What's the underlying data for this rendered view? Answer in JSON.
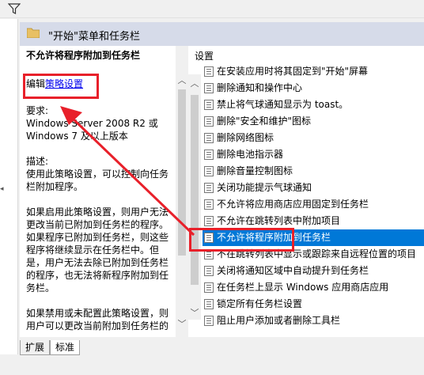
{
  "header": {
    "title": "\"开始\"菜单和任务栏"
  },
  "description": {
    "title": "不允许将程序附加到任务栏",
    "edit_prefix": "编辑",
    "edit_link": "策略设置",
    "req_label": "要求:",
    "req_text": "Windows Server 2008 R2 或 Windows 7 及以上版本",
    "desc_label": "描述:",
    "desc_text": "使用此策略设置，可以控制向任务栏附加程序。",
    "p1": "如果启用此策略设置，则用户无法更改当前已附加到任务栏的程序。如果程序已附加到任务栏，则这些程序将继续显示在任务栏中。但是，用户无法去除已附加到任务栏的程序，也无法将新程序附加到任务栏。",
    "p2": "如果禁用或未配置此策略设置，则用户可以更改当前附加到任务栏的"
  },
  "list": {
    "header": "设置",
    "items": [
      "在安装应用时将其固定到\"开始\"屏幕",
      "删除通知和操作中心",
      "禁止将气球通知显示为 toast。",
      "删除\"安全和维护\"图标",
      "删除网络图标",
      "删除电池指示器",
      "删除音量控制图标",
      "关闭功能提示气球通知",
      "不允许将应用商店应用固定到任务栏",
      "不允许在跳转列表中附加项目",
      "不允许将程序附加到任务栏",
      "不在跳转列表中显示或跟踪来自远程位置的项目",
      "关闭将通知区域中自动提升到任务栏",
      "在任务栏上显示 Windows 应用商店应用",
      "锁定所有任务栏设置",
      "阻止用户添加或者删除工具栏"
    ],
    "selected_index": 10
  },
  "tabs": [
    "扩展",
    "标准"
  ],
  "colors": {
    "selection": "#0078d7",
    "highlight": "#e8202a",
    "header_bg": "#d6dbe9"
  }
}
